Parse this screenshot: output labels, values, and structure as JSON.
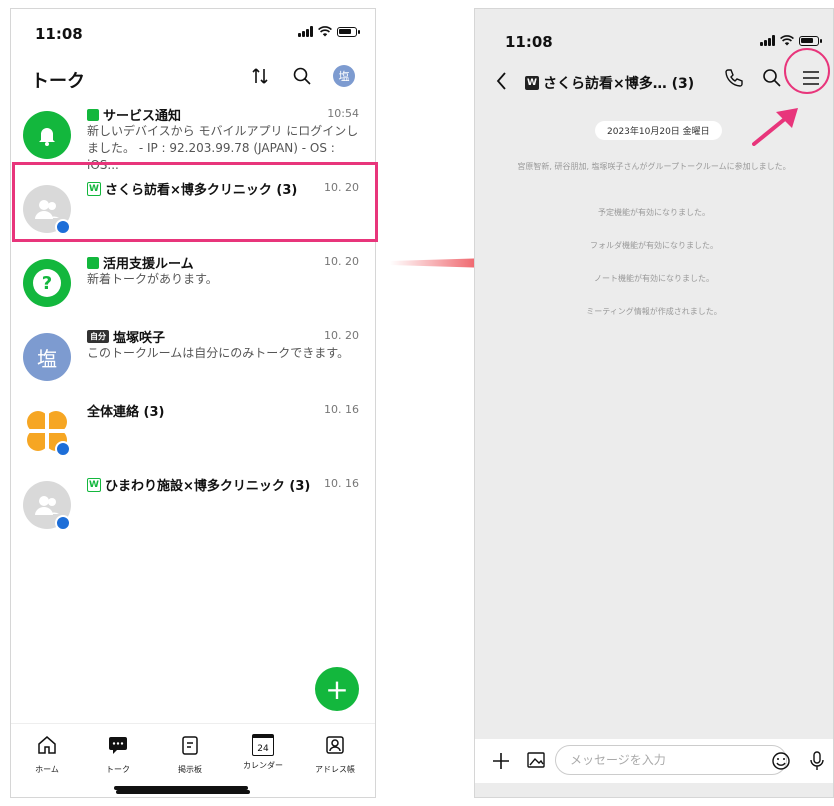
{
  "left": {
    "status_time": "11:08",
    "header_title": "トーク",
    "avatar_initial": "塩",
    "talks": [
      {
        "name": "サービス通知",
        "time": "10:54",
        "msg": "新しいデバイスから モバイルアプリ にログインしました。 - IP : 92.203.99.78 (JAPAN) - OS : iOS..."
      },
      {
        "name": "さくら訪看×博多クリニック (3)",
        "time": "10. 20",
        "msg": ""
      },
      {
        "name": "活用支援ルーム",
        "time": "10. 20",
        "msg": "新着トークがあります。"
      },
      {
        "name": "塩塚咲子",
        "time": "10. 20",
        "msg": "このトークルームは自分にのみトークできます。",
        "self_badge": "自分",
        "avatar_initial": "塩"
      },
      {
        "name": "全体連絡 (3)",
        "time": "10. 16",
        "msg": ""
      },
      {
        "name": "ひまわり施設×博多クリニック (3)",
        "time": "10. 16",
        "msg": ""
      }
    ],
    "tabs": [
      {
        "label": "ホーム"
      },
      {
        "label": "トーク"
      },
      {
        "label": "掲示板"
      },
      {
        "label": "カレンダー",
        "day": "24"
      },
      {
        "label": "アドレス帳"
      }
    ]
  },
  "right": {
    "status_time": "11:08",
    "room_title": "さくら訪看×博多… (3)",
    "date": "2023年10月20日 金曜日",
    "system_messages": [
      "宮原智新, 研谷朋加, 塩塚咲子さんがグループトークルームに参加しました。",
      "予定機能が有効になりました。",
      "フォルダ機能が有効になりました。",
      "ノート機能が有効になりました。",
      "ミーティング情報が作成されました。"
    ],
    "input_placeholder": "メッセージを入力"
  },
  "colors": {
    "accent_green": "#13b73d",
    "highlight_pink": "#e8357b",
    "arrow_red": "#e8202a"
  }
}
